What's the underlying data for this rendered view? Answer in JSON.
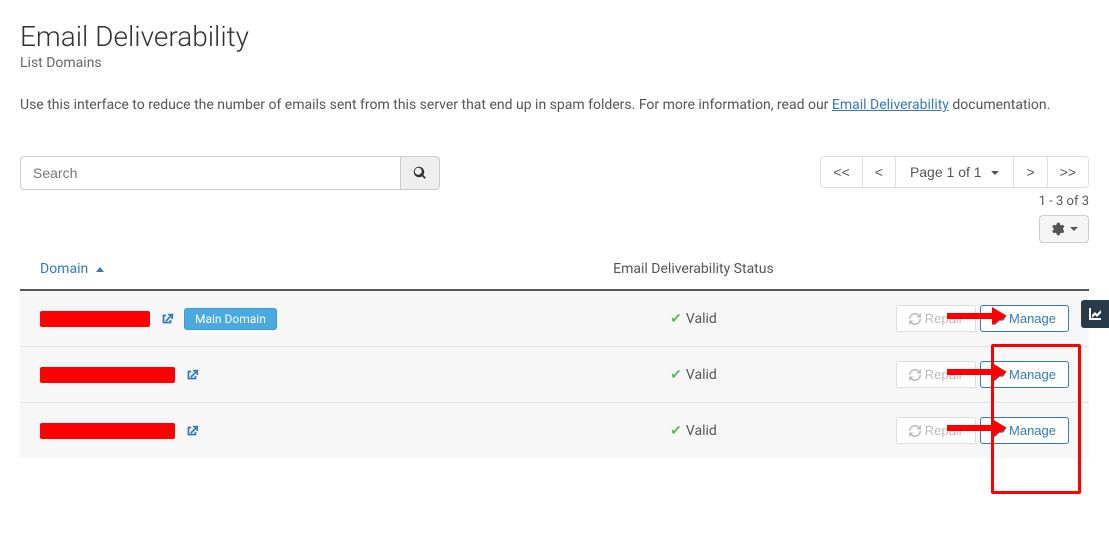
{
  "header": {
    "title": "Email Deliverability",
    "subtitle": "List Domains",
    "description_pre": "Use this interface to reduce the number of emails sent from this server that end up in spam folders. For more information, read our ",
    "description_link": "Email Deliverability",
    "description_post": " documentation."
  },
  "search": {
    "placeholder": "Search"
  },
  "pager": {
    "first": "<<",
    "prev": "<",
    "label": "Page 1 of 1",
    "next": ">",
    "last": ">>",
    "count": "1 - 3 of 3"
  },
  "table": {
    "columns": {
      "domain": "Domain",
      "status": "Email Deliverability Status"
    },
    "badge_main": "Main Domain",
    "status_valid": "Valid",
    "repair": "Repair",
    "manage": "Manage",
    "rows": [
      {
        "redact_width": 110,
        "is_main": true
      },
      {
        "redact_width": 135,
        "is_main": false
      },
      {
        "redact_width": 135,
        "is_main": false
      }
    ]
  }
}
